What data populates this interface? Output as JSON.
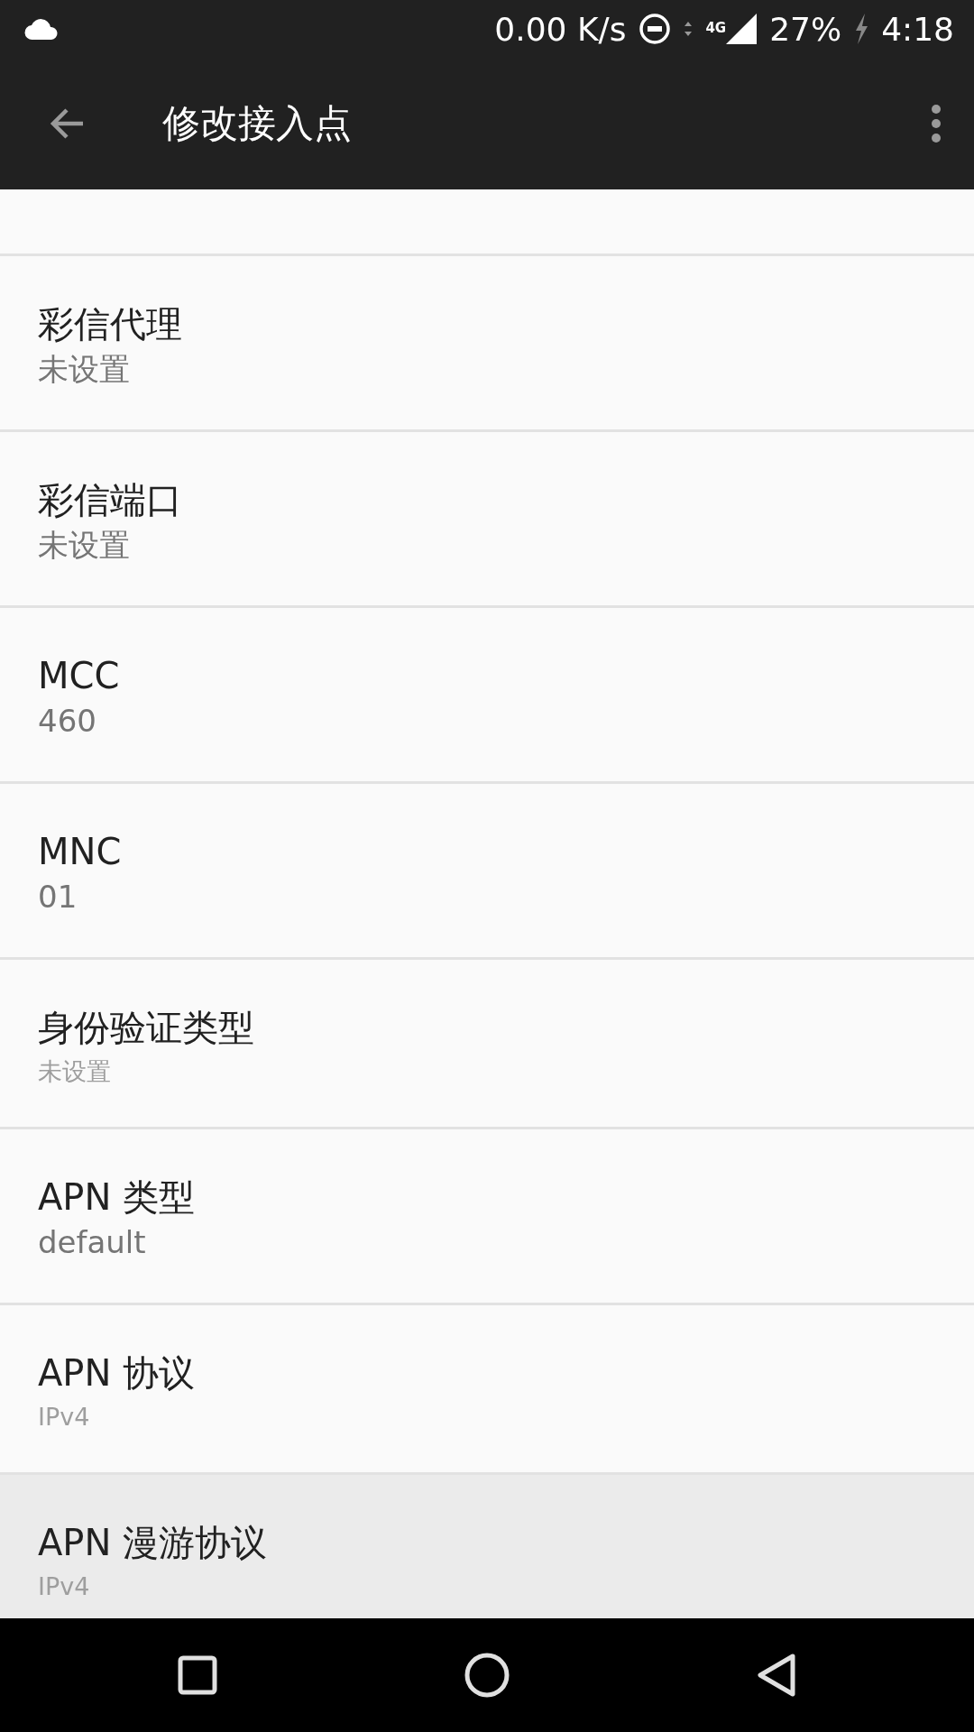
{
  "status_bar": {
    "speed": "0.00 K/s",
    "network": "4G",
    "battery": "27%",
    "charging": true,
    "time": "4:18"
  },
  "app_bar": {
    "title": "修改接入点"
  },
  "settings": [
    {
      "title": "彩信代理",
      "value": "未设置",
      "kind": "regular",
      "selected": false
    },
    {
      "title": "彩信端口",
      "value": "未设置",
      "kind": "regular",
      "selected": false
    },
    {
      "title": "MCC",
      "value": "460",
      "kind": "regular",
      "selected": false
    },
    {
      "title": "MNC",
      "value": "01",
      "kind": "regular",
      "selected": false
    },
    {
      "title": "身份验证类型",
      "value": "未设置",
      "kind": "compact",
      "selected": false
    },
    {
      "title": "APN 类型",
      "value": "default",
      "kind": "regular",
      "selected": false
    },
    {
      "title": "APN 协议",
      "value": "IPv4",
      "kind": "compact",
      "selected": false
    },
    {
      "title": "APN 漫游协议",
      "value": "IPv4",
      "kind": "compact",
      "selected": true
    }
  ]
}
